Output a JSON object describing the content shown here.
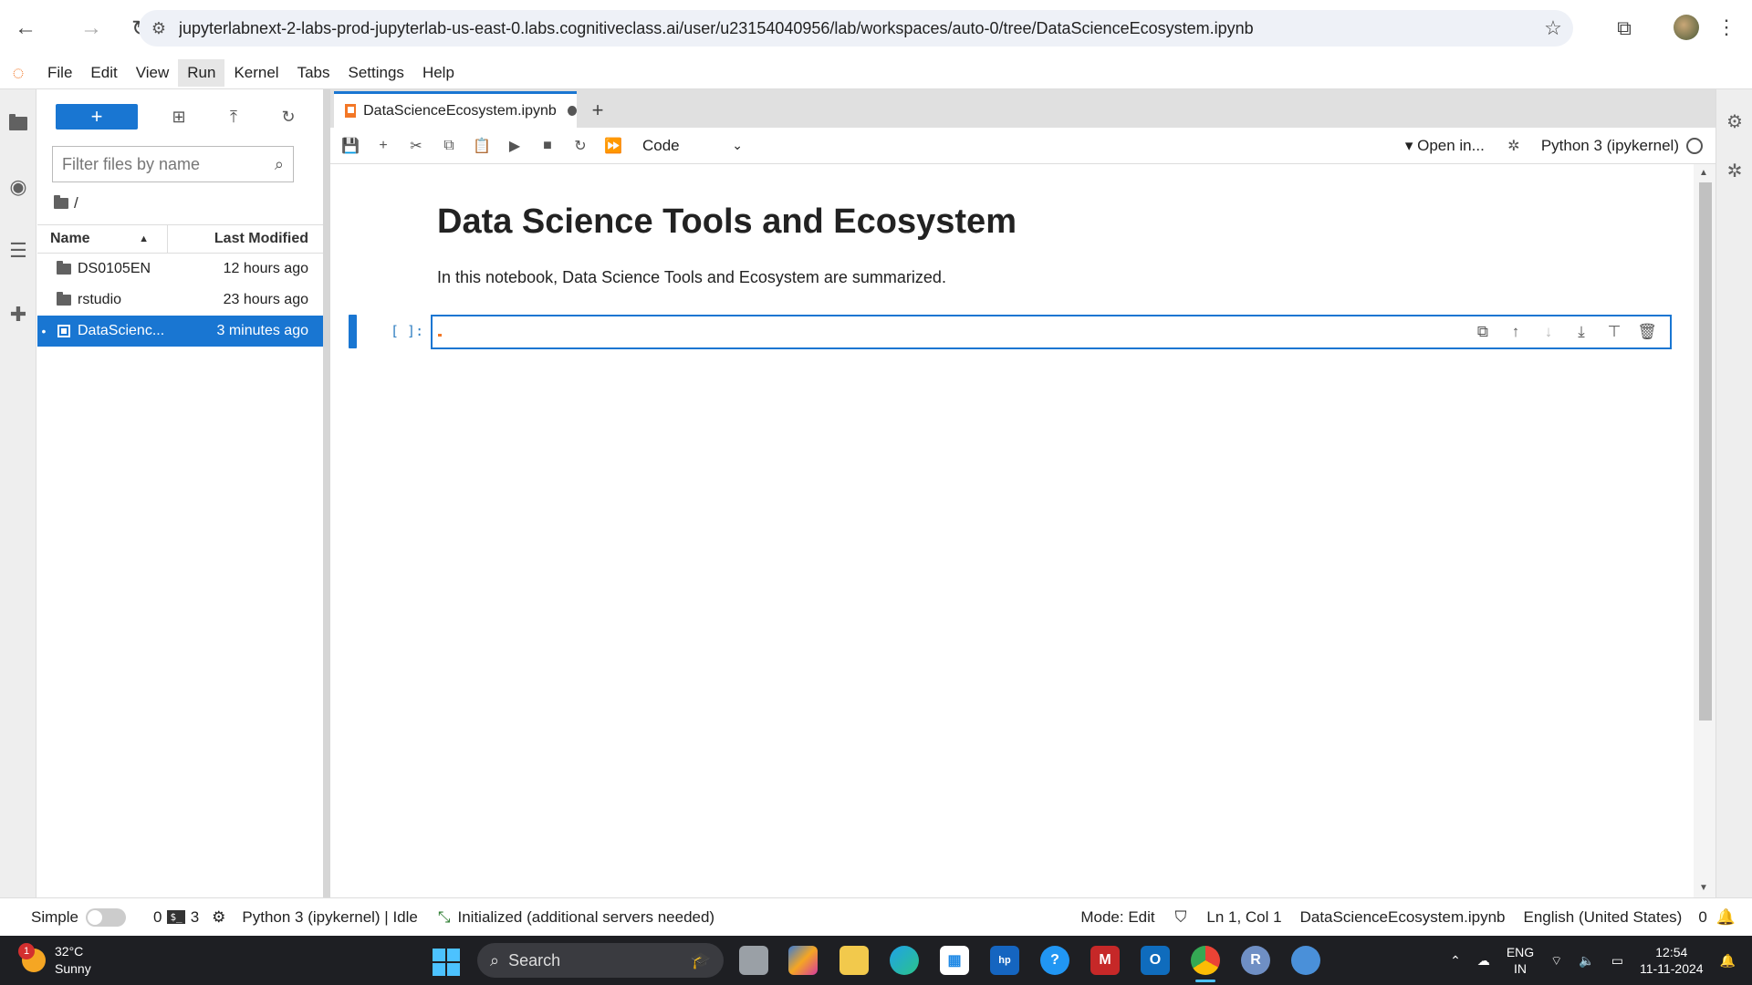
{
  "browser": {
    "url": "jupyterlabnext-2-labs-prod-jupyterlab-us-east-0.labs.cognitiveclass.ai/user/u23154040956/lab/workspaces/auto-0/tree/DataScienceEcosystem.ipynb"
  },
  "menubar": {
    "items": [
      "File",
      "Edit",
      "View",
      "Run",
      "Kernel",
      "Tabs",
      "Settings",
      "Help"
    ]
  },
  "filebrowser": {
    "new_label": "+",
    "filter_placeholder": "Filter files by name",
    "breadcrumb": "/",
    "col_name": "Name",
    "col_modified": "Last Modified",
    "files": [
      {
        "name": "DS0105EN",
        "modified": "12 hours ago",
        "type": "folder"
      },
      {
        "name": "rstudio",
        "modified": "23 hours ago",
        "type": "folder"
      },
      {
        "name": "DataScienc...",
        "modified": "3 minutes ago",
        "type": "notebook"
      }
    ]
  },
  "notebook": {
    "tab_title": "DataScienceEcosystem.ipynb",
    "cell_type": "Code",
    "open_in": "Open in...",
    "kernel": "Python 3 (ipykernel)",
    "heading": "Data Science Tools and Ecosystem",
    "intro": "In this notebook, Data Science Tools and Ecosystem are summarized.",
    "prompt": "[ ]:"
  },
  "statusbar": {
    "mode_simple": "Simple",
    "count1": "0",
    "count2": "3",
    "kernel_status": "Python 3 (ipykernel) | Idle",
    "lsp_status": "Initialized (additional servers needed)",
    "mode": "Mode: Edit",
    "position": "Ln 1, Col 1",
    "filename": "DataScienceEcosystem.ipynb",
    "language": "English (United States)",
    "notifications": "0"
  },
  "taskbar": {
    "weather_temp": "32°C",
    "weather_desc": "Sunny",
    "weather_badge": "1",
    "search_label": "Search",
    "lang": "ENG",
    "region": "IN",
    "time": "12:54",
    "date": "11-11-2024"
  }
}
